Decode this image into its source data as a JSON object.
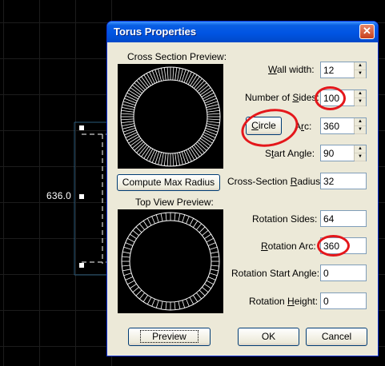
{
  "dialog": {
    "title": "Torus Properties",
    "close_icon": "close-icon"
  },
  "background": {
    "dimension_label": "636.0",
    "grid_color": "#1c1c1c",
    "selection_color": "#ffffff"
  },
  "left": {
    "cross_section_title": "Cross Section Preview:",
    "compute_button": "Compute Max Radius",
    "top_view_title": "Top View Preview:",
    "preview_button": "Preview"
  },
  "fields": {
    "wall_width": {
      "prefix": "",
      "u": "W",
      "suffix": "all width:",
      "value": "12"
    },
    "num_sides": {
      "prefix": "Number of ",
      "u": "S",
      "suffix": "ides:",
      "value": "100"
    },
    "circle_button": {
      "prefix": "",
      "u": "C",
      "suffix": "ircle"
    },
    "arc": {
      "prefix": "A",
      "u": "r",
      "suffix": "c:",
      "value": "360"
    },
    "start_angle": {
      "prefix": "S",
      "u": "t",
      "suffix": "art Angle:",
      "value": "90"
    },
    "cs_radius": {
      "prefix": "Cross-Section ",
      "u": "R",
      "suffix": "adius:",
      "value": "32"
    },
    "rotation_sides": {
      "label": "Rotation Sides:",
      "value": "64"
    },
    "rotation_arc": {
      "prefix": "",
      "u": "R",
      "suffix": "otation Arc:",
      "value": "360"
    },
    "rotation_start": {
      "label": "Rotation Start Angle:",
      "value": "0"
    },
    "rotation_height": {
      "prefix": "Rotation ",
      "u": "H",
      "suffix": "eight:",
      "value": "0"
    }
  },
  "buttons": {
    "ok": "OK",
    "cancel": "Cancel"
  },
  "colors": {
    "annotation": "#e4171b",
    "titlebar": "#0054e3"
  }
}
